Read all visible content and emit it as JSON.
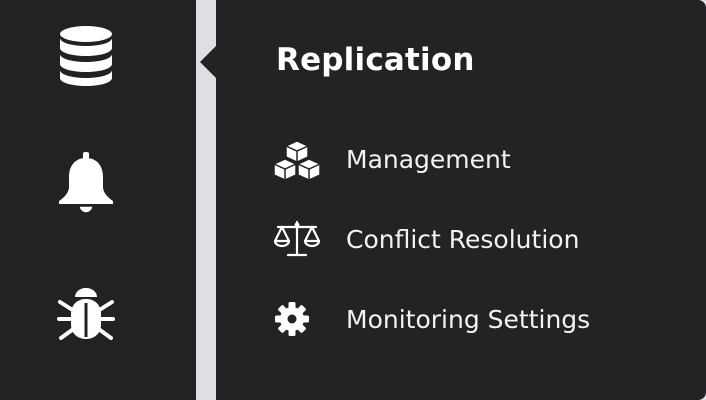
{
  "sidebar": {
    "items": [
      {
        "icon": "database-icon"
      },
      {
        "icon": "bell-icon"
      },
      {
        "icon": "bug-icon"
      }
    ]
  },
  "popup": {
    "title": "Replication",
    "items": [
      {
        "label": "Management",
        "icon": "cubes-icon"
      },
      {
        "label": "Conflict Resolution",
        "icon": "balance-scale-icon"
      },
      {
        "label": "Monitoring Settings",
        "icon": "gear-icon"
      }
    ]
  },
  "colors": {
    "sidebar_bg": "#222224",
    "popup_bg": "#232326",
    "text": "#ffffff",
    "page_bg": "#dfdfe3"
  }
}
